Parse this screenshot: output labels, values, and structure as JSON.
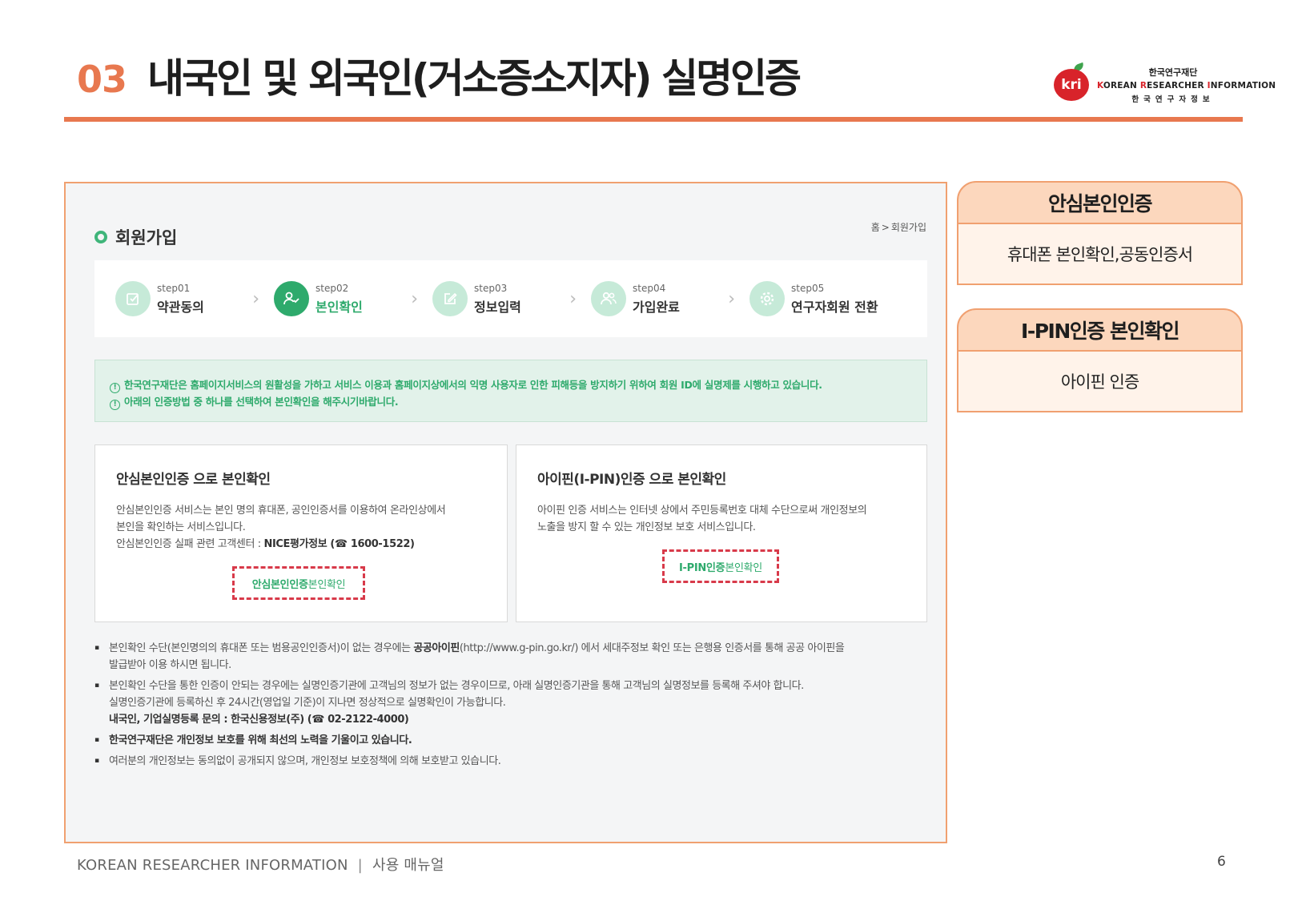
{
  "slide": {
    "section_number": "03",
    "title": "내국인 및 외국인(거소증소지자) 실명인증",
    "logo": {
      "mark": "kri",
      "korean": "한국연구재단",
      "english_parts": [
        "K",
        "OREAN ",
        "R",
        "ESEARCHER ",
        "I",
        "NFORMATION"
      ],
      "spaced": "한국연구자정보"
    },
    "accent_color": "#e8784f"
  },
  "screen": {
    "heading": "회원가입",
    "breadcrumb": {
      "home": "홈",
      "separator": ">",
      "current": "회원가입"
    },
    "steps": [
      {
        "label": "step01",
        "name": "약관동의",
        "icon": "check-square-icon"
      },
      {
        "label": "step02",
        "name": "본인확인",
        "icon": "user-check-icon"
      },
      {
        "label": "step03",
        "name": "정보입력",
        "icon": "edit-icon"
      },
      {
        "label": "step04",
        "name": "가입완료",
        "icon": "users-icon"
      },
      {
        "label": "step05",
        "name": "연구자회원 전환",
        "icon": "gear-icon"
      }
    ],
    "active_step": 1,
    "notice": [
      "한국연구재단은 홈페이지서비스의 원활성을 가하고 서비스 이용과 홈페이지상에서의 익명 사용자로 인한 피해등을 방지하기 위하여 회원 ID에 실명제를 시행하고 있습니다.",
      "아래의 인증방법 중 하나를 선택하여 본인확인을 해주시기바랍니다."
    ],
    "cards": {
      "safe": {
        "title": "안심본인인증 으로 본인확인",
        "lines": [
          "안심본인인증 서비스는 본인 명의 휴대폰, 공인인증서를 이용하여 온라인상에서",
          "본인을 확인하는 서비스입니다."
        ],
        "contact_prefix": "안심본인인증 실패 관련 고객센터 : ",
        "contact_bold": "NICE평가정보 (☎ 1600-1522)",
        "button_bold": "안심본인인증",
        "button_rest": " 본인확인"
      },
      "ipin": {
        "title": "아이핀(I-PIN)인증 으로 본인확인",
        "lines": [
          "아이핀 인증 서비스는 인터넷 상에서 주민등록번호 대체 수단으로써 개인정보의",
          "노출을 방지 할 수 있는 개인정보 보호 서비스입니다."
        ],
        "button_bold": "I-PIN인증",
        "button_rest": " 본인확인"
      }
    },
    "notes": {
      "n1a": "본인확인 수단(본인명의의 휴대폰 또는 범용공인인증서)이 없는 경우에는 ",
      "n1b": "공공아이핀",
      "n1c": "(http://www.g-pin.go.kr/) 에서 세대주정보 확인 또는 은행용 인증서를 통해 공공 아이핀을",
      "n1d": "발급받아 이용 하시면 됩니다.",
      "n2a": "본인확인 수단을 통한 인증이 안되는 경우에는 실명인증기관에 고객님의 정보가 없는 경우이므로, 아래 실명인증기관을 통해 고객님의 실명정보를 등록해 주셔야 합니다.",
      "n2b": "실명인증기관에 등록하신 후 24시간(영업일 기준)이 지나면 정상적으로 실명확인이 가능합니다.",
      "n2c": "내국인, 기업실명등록 문의 : 한국신용정보(주) (☎ 02-2122-4000)",
      "n3": "한국연구재단은 개인정보 보호를 위해 최선의 노력을 기울이고 있습니다.",
      "n4": "여러분의 개인정보는 동의없이 공개되지 않으며, 개인정보 보호정책에 의해 보호받고 있습니다."
    }
  },
  "side": {
    "box1": {
      "title": "안심본인인증",
      "body": "휴대폰 본인확인,공동인증서"
    },
    "box2": {
      "title": "I-PIN인증 본인확인",
      "body": "아이핀 인증"
    }
  },
  "footer": {
    "left": "KOREAN RESEARCHER INFORMATION",
    "separator": "|",
    "right": "사용 매뉴얼",
    "page": "6"
  }
}
